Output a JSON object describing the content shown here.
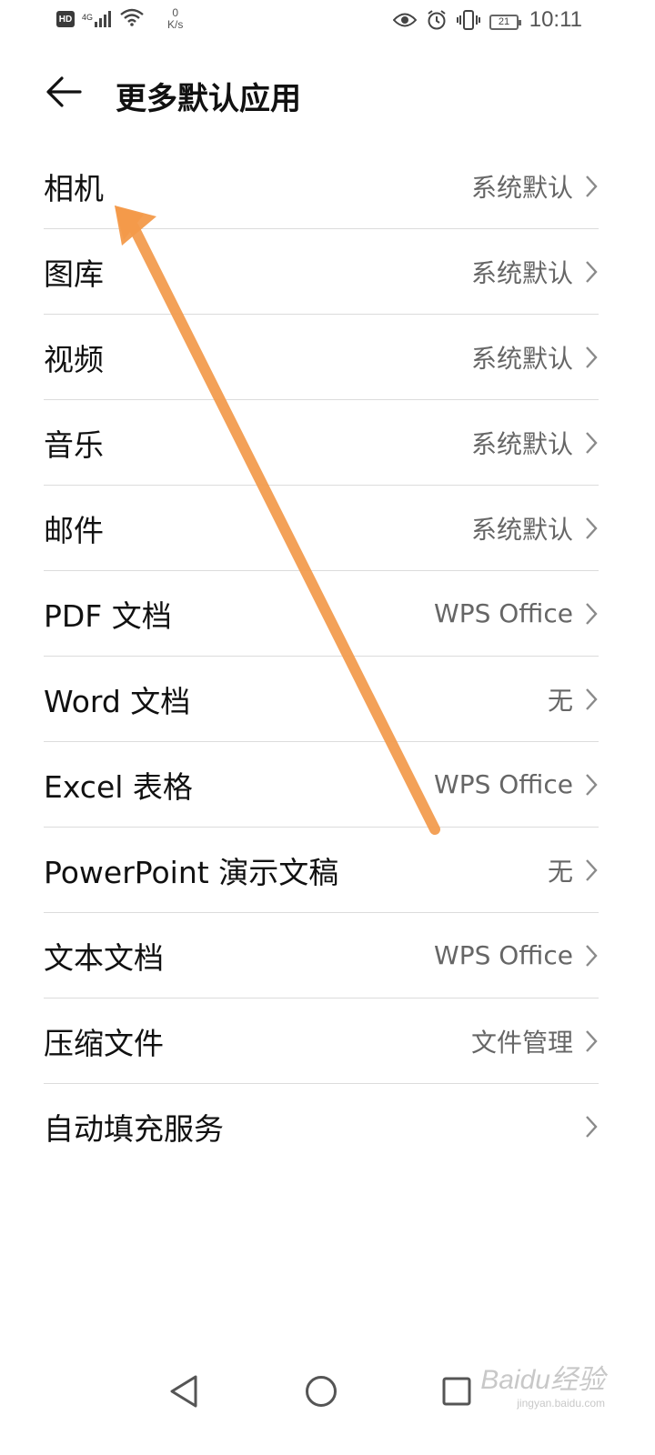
{
  "status_bar": {
    "hd": "HD",
    "network": "4G",
    "speed_value": "0",
    "speed_unit": "K/s",
    "battery": "21",
    "time": "10:11"
  },
  "header": {
    "title": "更多默认应用"
  },
  "rows": [
    {
      "label": "相机",
      "value": "系统默认"
    },
    {
      "label": "图库",
      "value": "系统默认"
    },
    {
      "label": "视频",
      "value": "系统默认"
    },
    {
      "label": "音乐",
      "value": "系统默认"
    },
    {
      "label": "邮件",
      "value": "系统默认"
    },
    {
      "label": "PDF 文档",
      "value": "WPS Office"
    },
    {
      "label": "Word 文档",
      "value": "无"
    },
    {
      "label": "Excel 表格",
      "value": "WPS Office"
    },
    {
      "label": "PowerPoint 演示文稿",
      "value": "无"
    },
    {
      "label": "文本文档",
      "value": "WPS Office"
    },
    {
      "label": "压缩文件",
      "value": "文件管理"
    },
    {
      "label": "自动填充服务",
      "value": ""
    }
  ],
  "watermark": {
    "main": "Baidu经验",
    "sub": "jingyan.baidu.com"
  },
  "colors": {
    "annotation_arrow": "#f39a4a",
    "divider": "#dcdcdc",
    "secondary_text": "#666666"
  },
  "icons": {
    "back": "arrow-left-icon",
    "chevron": "chevron-right-icon",
    "nav_back": "triangle-back-icon",
    "nav_home": "circle-home-icon",
    "nav_recents": "square-recents-icon"
  }
}
